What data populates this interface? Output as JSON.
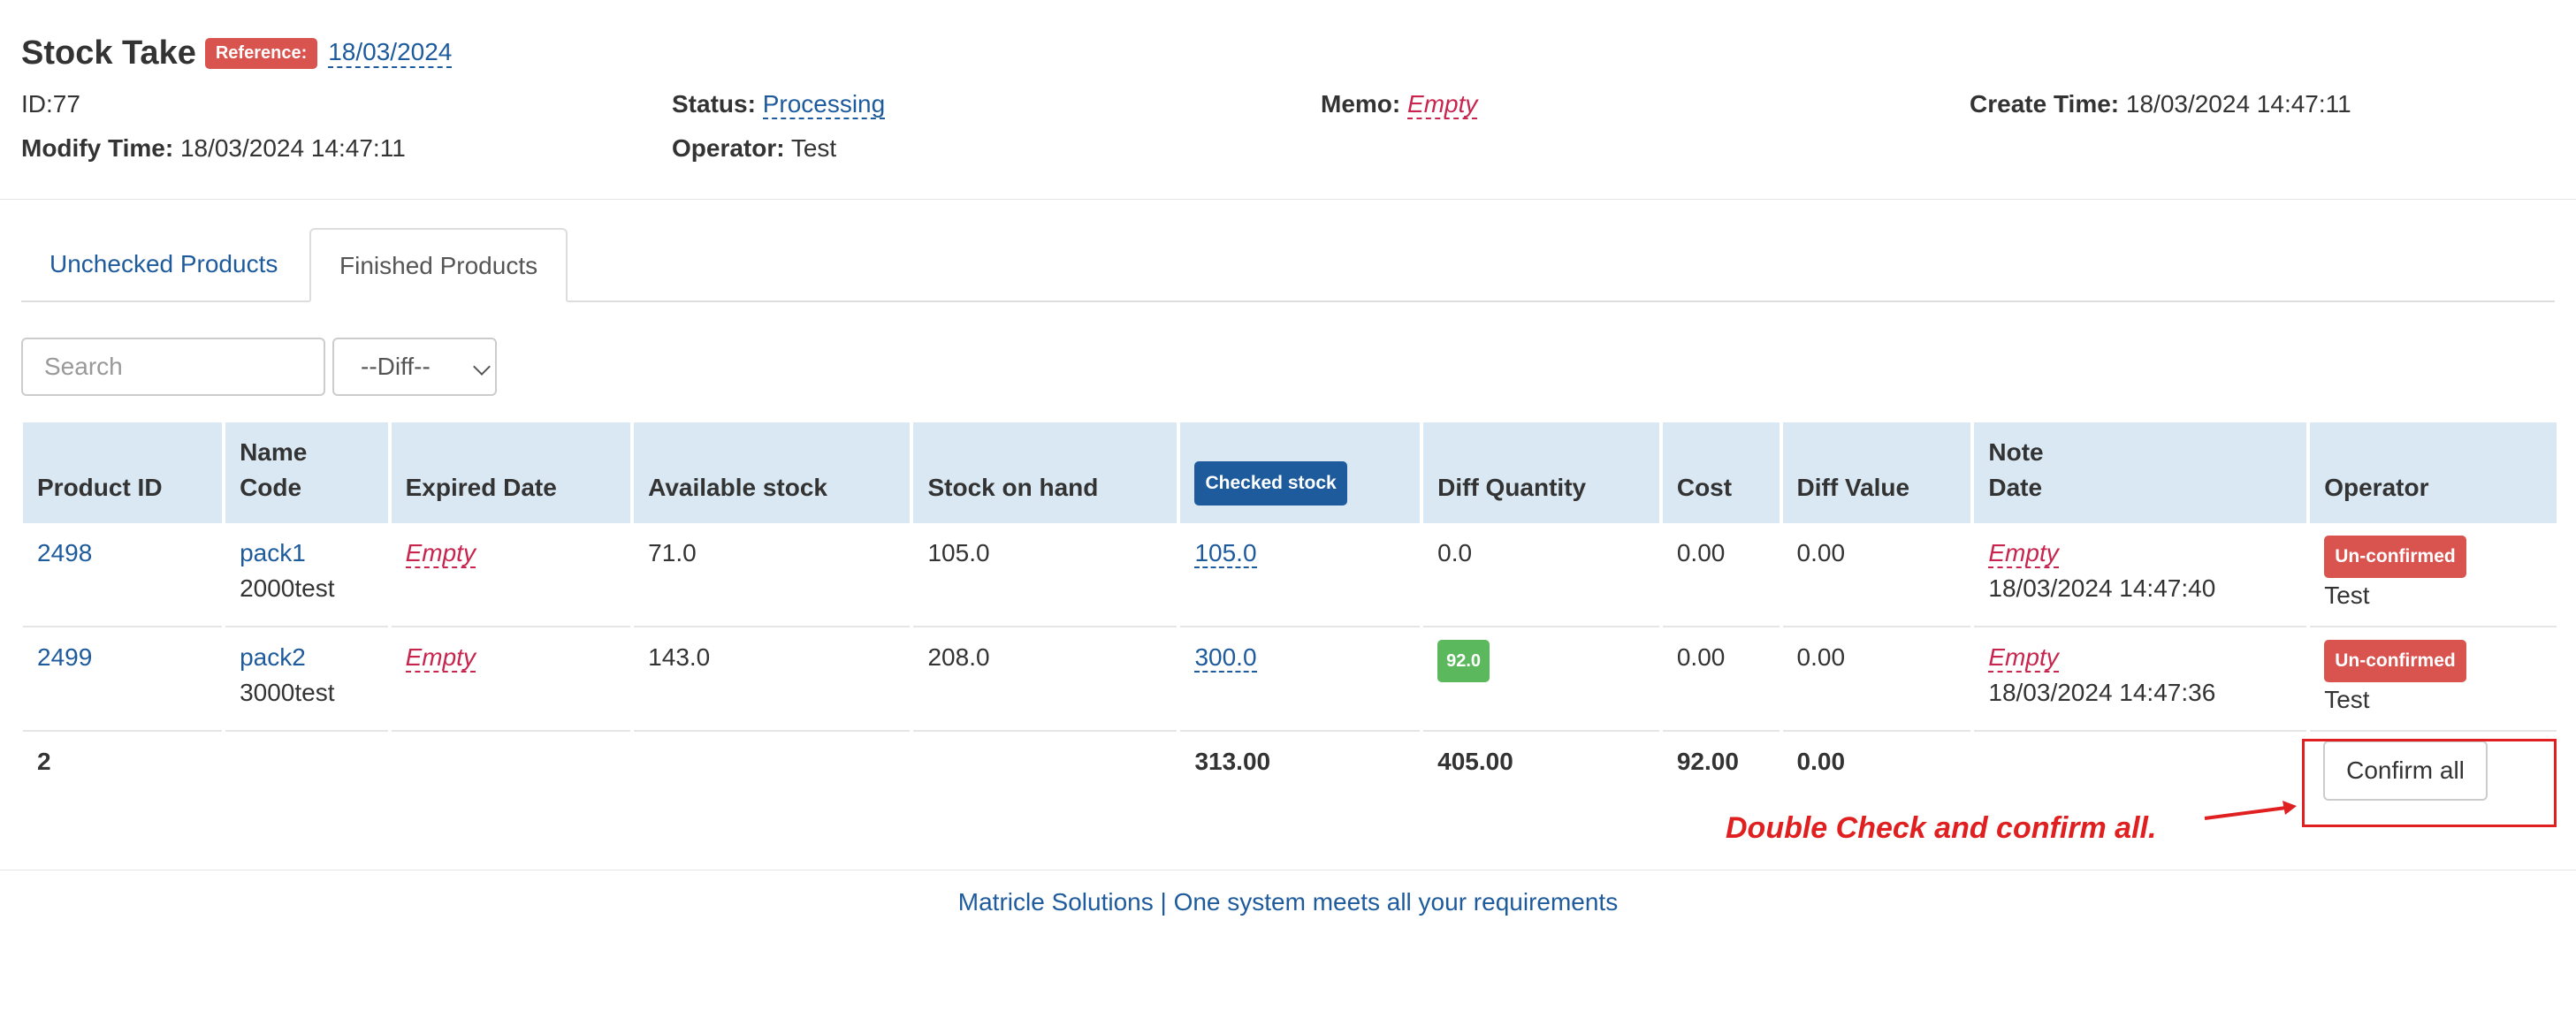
{
  "header": {
    "title": "Stock Take",
    "reference_label": "Reference:",
    "reference_value": "18/03/2024",
    "id_text": "ID:77",
    "status_label": "Status:",
    "status_value": "Processing",
    "memo_label": "Memo:",
    "memo_value": "Empty",
    "create_time_label": "Create Time:",
    "create_time_value": "18/03/2024 14:47:11",
    "modify_time_label": "Modify Time:",
    "modify_time_value": "18/03/2024 14:47:11",
    "operator_label": "Operator:",
    "operator_value": "Test"
  },
  "tabs": [
    {
      "label": "Unchecked Products",
      "active": false
    },
    {
      "label": "Finished Products",
      "active": true
    }
  ],
  "filters": {
    "search_placeholder": "Search",
    "diff_selected": "--Diff--"
  },
  "table": {
    "headers": {
      "product_id": "Product ID",
      "name": "Name",
      "code": "Code",
      "expired_date": "Expired Date",
      "available_stock": "Available stock",
      "stock_on_hand": "Stock on hand",
      "checked_stock": "Checked stock",
      "diff_quantity": "Diff Quantity",
      "cost": "Cost",
      "diff_value": "Diff Value",
      "note": "Note",
      "date": "Date",
      "operator": "Operator"
    },
    "rows": [
      {
        "product_id": "2498",
        "name": "pack1",
        "code": "2000test",
        "expired_date": "Empty",
        "available_stock": "71.0",
        "stock_on_hand": "105.0",
        "checked_stock": "105.0",
        "diff_quantity": "0.0",
        "cost": "0.00",
        "diff_value": "0.00",
        "note": "Empty",
        "date": "18/03/2024 14:47:40",
        "status": "Un-confirmed",
        "operator": "Test"
      },
      {
        "product_id": "2499",
        "name": "pack2",
        "code": "3000test",
        "expired_date": "Empty",
        "available_stock": "143.0",
        "stock_on_hand": "208.0",
        "checked_stock": "300.0",
        "diff_quantity": "92.0",
        "cost": "0.00",
        "diff_value": "0.00",
        "note": "Empty",
        "date": "18/03/2024 14:47:36",
        "status": "Un-confirmed",
        "operator": "Test"
      }
    ],
    "totals": {
      "count": "2",
      "checked_stock": "313.00",
      "diff_quantity": "405.00",
      "cost": "92.00",
      "diff_value": "0.00"
    }
  },
  "actions": {
    "confirm_all": "Confirm all"
  },
  "annotation": {
    "text": "Double Check and confirm all."
  },
  "footer": {
    "text": "Matricle Solutions | One system meets all your requirements"
  },
  "colors": {
    "link": "#1e5b9c",
    "danger": "#d9534f",
    "success": "#5cb85c",
    "header_bg": "#d9e8f2",
    "annotation": "#e02020"
  }
}
